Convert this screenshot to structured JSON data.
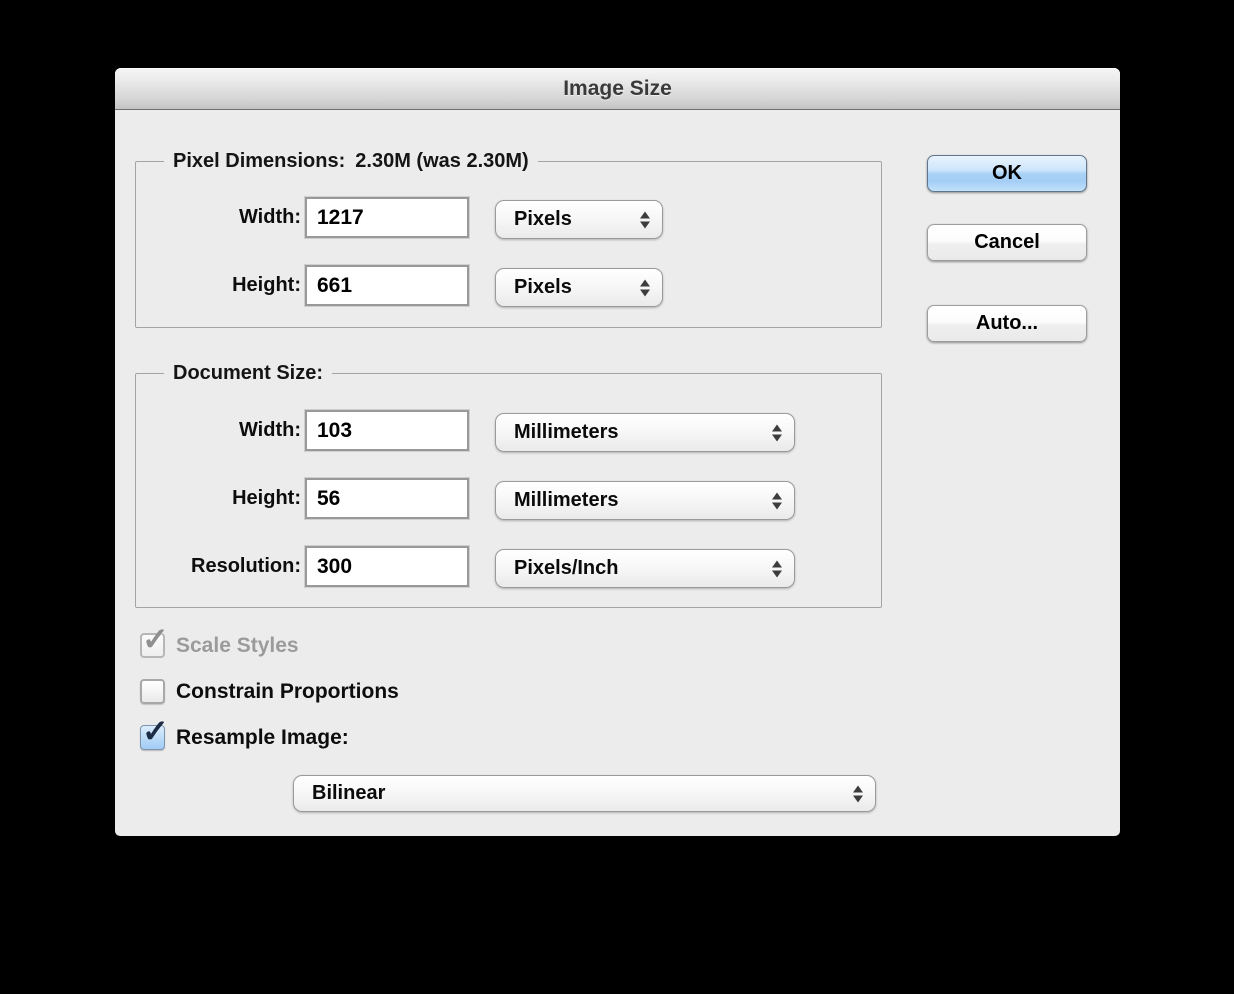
{
  "window": {
    "title": "Image Size"
  },
  "colors": {
    "dialog_bg": "#ececec",
    "title_text": "#3a3a3a",
    "default_button_blue": "#a8d1f6",
    "checkbox_blue": "#bcdcf8",
    "disabled_text": "#9b9b9b"
  },
  "icons": {
    "checkmark": "✓"
  },
  "pixel_dimensions": {
    "legend": "Pixel Dimensions:",
    "legend_value": "2.30M (was 2.30M)",
    "rows": [
      {
        "label": "Width:",
        "value": "1217",
        "unit": "Pixels"
      },
      {
        "label": "Height:",
        "value": "661",
        "unit": "Pixels"
      }
    ]
  },
  "document_size": {
    "legend": "Document Size:",
    "rows": [
      {
        "label": "Width:",
        "value": "103",
        "unit": "Millimeters"
      },
      {
        "label": "Height:",
        "value": "56",
        "unit": "Millimeters"
      },
      {
        "label": "Resolution:",
        "value": "300",
        "unit": "Pixels/Inch"
      }
    ]
  },
  "buttons": {
    "ok": "OK",
    "cancel": "Cancel",
    "auto": "Auto..."
  },
  "checkboxes": [
    {
      "label": "Scale Styles",
      "checked": true,
      "disabled": true
    },
    {
      "label": "Constrain Proportions",
      "checked": false,
      "disabled": false
    },
    {
      "label": "Resample Image:",
      "checked": true,
      "disabled": false
    }
  ],
  "resample_method": {
    "value": "Bilinear"
  }
}
